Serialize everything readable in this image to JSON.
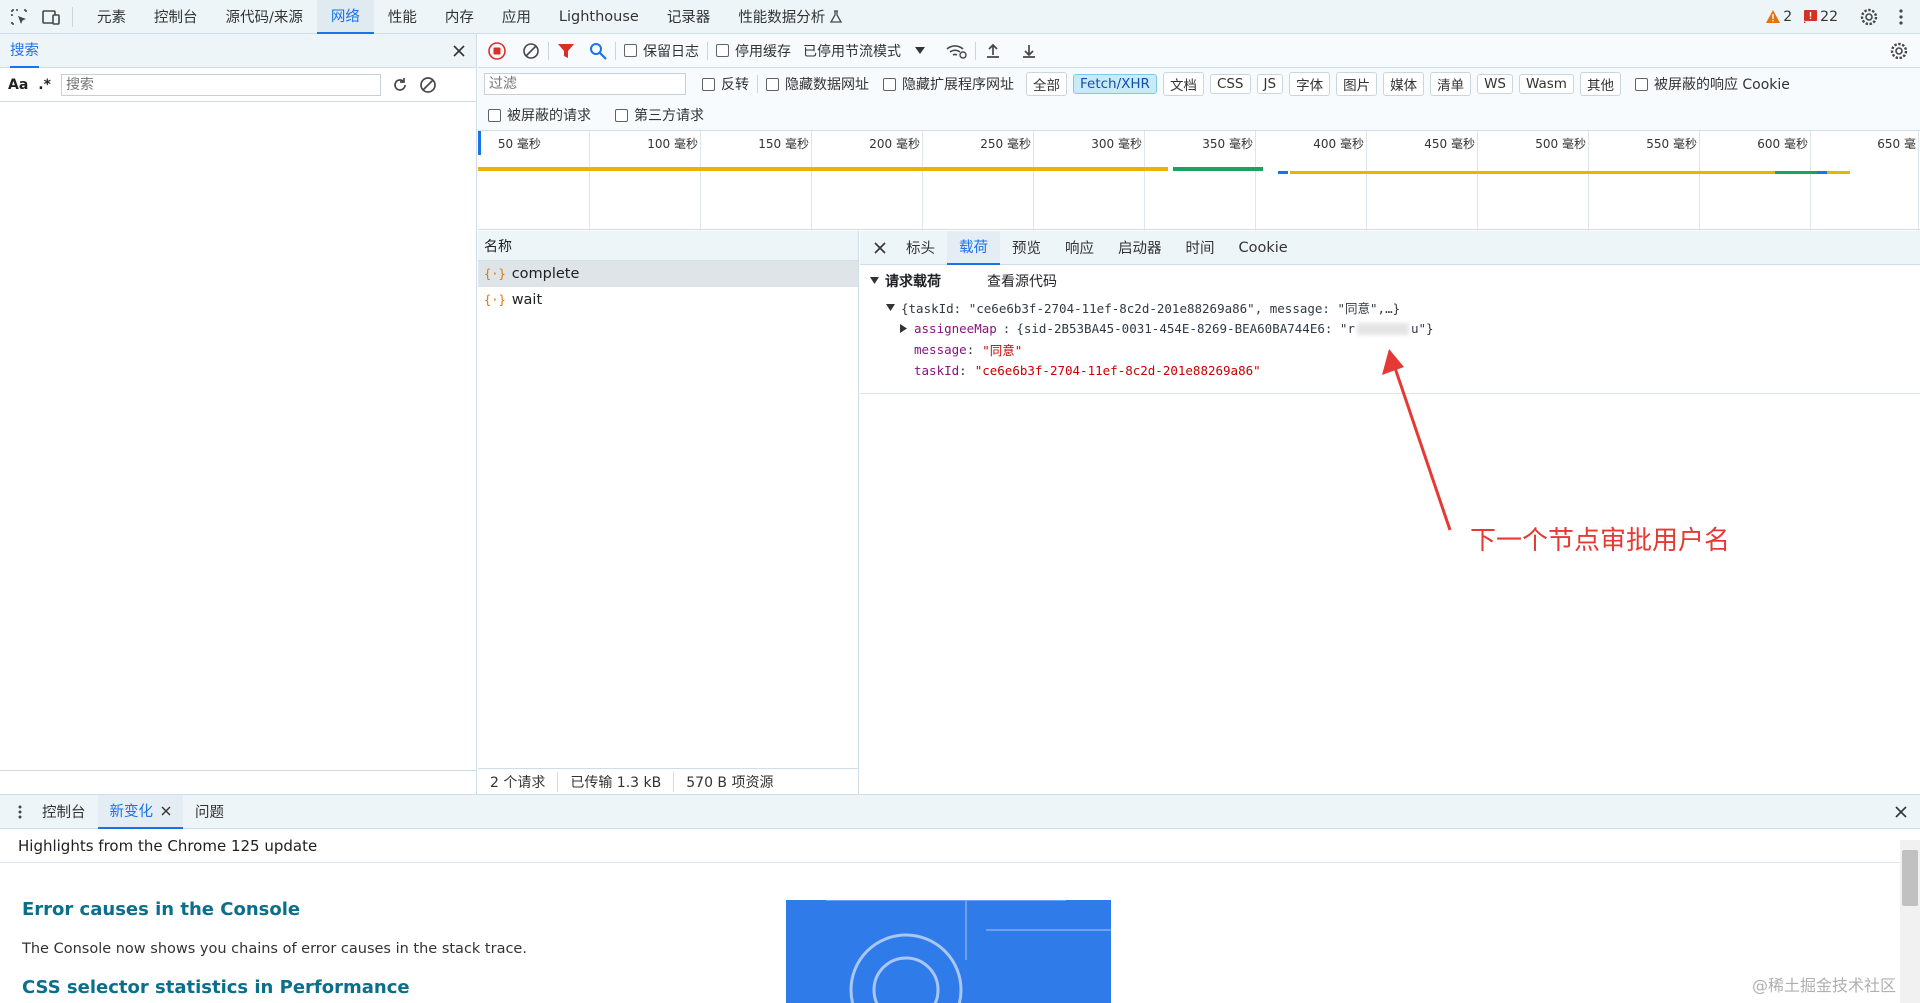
{
  "topbar": {
    "tabs": [
      "元素",
      "控制台",
      "源代码/来源",
      "网络",
      "性能",
      "内存",
      "应用",
      "Lighthouse",
      "记录器",
      "性能数据分析"
    ],
    "active_tab": "网络",
    "warnings": "2",
    "errors": "22",
    "warning_color": "#e8710a",
    "error_color": "#d93025"
  },
  "search": {
    "tab_label": "搜索",
    "case_label": "Aa",
    "regex_label": ".*",
    "placeholder": "搜索"
  },
  "toolbar": {
    "preserve_log": "保留日志",
    "disable_cache": "停用缓存",
    "throttling": "已停用节流模式"
  },
  "filters": {
    "placeholder": "过滤",
    "invert": "反转",
    "hide_data_urls": "隐藏数据网址",
    "hide_extension_urls": "隐藏扩展程序网址",
    "types": [
      "全部",
      "Fetch/XHR",
      "文档",
      "CSS",
      "JS",
      "字体",
      "图片",
      "媒体",
      "清单",
      "WS",
      "Wasm",
      "其他"
    ],
    "active_type": "Fetch/XHR",
    "blocked_cookies": "被屏蔽的响应 Cookie",
    "blocked_requests": "被屏蔽的请求",
    "third_party": "第三方请求"
  },
  "timeline": {
    "ticks": [
      "50 毫秒",
      "100 毫秒",
      "150 毫秒",
      "200 毫秒",
      "250 毫秒",
      "300 毫秒",
      "350 毫秒",
      "400 毫秒",
      "450 毫秒",
      "500 毫秒",
      "550 毫秒",
      "600 毫秒",
      "650 毫"
    ]
  },
  "requests": {
    "header": "名称",
    "rows": [
      {
        "name": "complete",
        "selected": true
      },
      {
        "name": "wait",
        "selected": false
      }
    ],
    "status": {
      "count": "2 个请求",
      "transferred": "已传输 1.3 kB",
      "resources": "570 B 项资源"
    }
  },
  "detail": {
    "tabs": [
      "标头",
      "载荷",
      "预览",
      "响应",
      "启动器",
      "时间",
      "Cookie"
    ],
    "active_tab": "载荷",
    "section_title": "请求载荷",
    "view_source": "查看源代码",
    "summary": "{taskId: \"ce6e6b3f-2704-11ef-8c2d-201e88269a86\", message: \"同意\",…}",
    "assignee_key": "assigneeMap",
    "assignee_value": "{sid-2B53BA45-0031-454E-8269-BEA60BA744E6: \"r",
    "assignee_tail": "u\"}",
    "message_key": "message",
    "message_value": "\"同意\"",
    "taskid_key": "taskId",
    "taskid_value": "\"ce6e6b3f-2704-11ef-8c2d-201e88269a86\""
  },
  "annotation": {
    "text": "下一个节点审批用户名",
    "color": "#e53935"
  },
  "drawer": {
    "tabs": [
      "控制台",
      "新变化",
      "问题"
    ],
    "active_tab": "新变化",
    "headline": "Highlights from the Chrome 125 update",
    "items": [
      {
        "title": "Error causes in the Console",
        "desc": "The Console now shows you chains of error causes in the stack trace."
      },
      {
        "title": "CSS selector statistics in Performance"
      }
    ],
    "watermark": "@稀土掘金技术社区"
  }
}
